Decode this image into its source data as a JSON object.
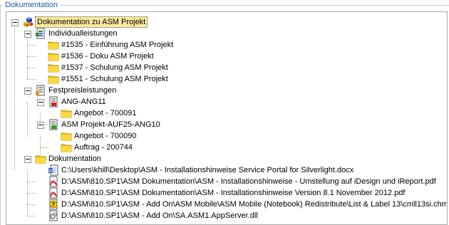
{
  "groupbox": {
    "title": "Dokumentation"
  },
  "tree": {
    "root": {
      "label": "Dokumentation zu ASM Projekt",
      "icon": "project-cubes-icon"
    },
    "individual": {
      "label": "Individualleistungen",
      "icon": "document-table-icon",
      "items": [
        {
          "label": "#1535 - Einführung ASM Projekt",
          "icon": "folder-icon"
        },
        {
          "label": "#1536 - Doku ASM Projekt",
          "icon": "folder-icon"
        },
        {
          "label": "#1537 - Schulung ASM Projekt",
          "icon": "folder-icon"
        },
        {
          "label": "#1551 - Schulung ASM Projekt",
          "icon": "folder-icon"
        }
      ]
    },
    "fixed": {
      "label": "Festpreisleistungen",
      "icon": "document-list-icon",
      "ang": {
        "label": "ANG-ANG11",
        "icon": "document-red-icon",
        "items": [
          {
            "label": "Angebot - 700091",
            "icon": "folder-icon"
          }
        ]
      },
      "auf": {
        "label": "ASM Projekt-AUF25-ANG10",
        "icon": "document-green-icon",
        "items": [
          {
            "label": "Angebot - 700090",
            "icon": "folder-icon"
          },
          {
            "label": "Auftrag - 200744",
            "icon": "folder-icon"
          }
        ]
      }
    },
    "docs": {
      "label": "Dokumentation",
      "icon": "folder-icon",
      "items": [
        {
          "label": "C:\\Users\\khill\\Desktop\\ASM - Installationshinweise  Service Portal for Silverlight.docx",
          "icon": "word-document-icon"
        },
        {
          "label": "D:\\ASM\\810.SP1\\ASM Dokumentation\\ASM - Installationshinweise - Umstellung auf iDesign und iReport.pdf",
          "icon": "pdf-document-icon"
        },
        {
          "label": "D:\\ASM\\810.SP1\\ASM Dokumentation\\ASM - Installationshinweise  Version 8.1 November 2012.pdf",
          "icon": "pdf-document-icon"
        },
        {
          "label": "D:\\ASM\\810.SP1\\ASM - Add On\\ASM Mobile\\ASM Mobile (Notebook) Redistribute\\List & Label 13\\cmll13si.chm",
          "icon": "help-document-icon"
        },
        {
          "label": "D:\\ASM\\810.SP1\\ASM - Add On\\SA.ASM1.AppServer.dll",
          "icon": "dll-document-icon"
        }
      ]
    }
  },
  "colors": {
    "selection": "#fbe9a1",
    "folder": "#f5c400",
    "pdf_red": "#c8201c",
    "groupbox_title": "#1e5aa8"
  }
}
